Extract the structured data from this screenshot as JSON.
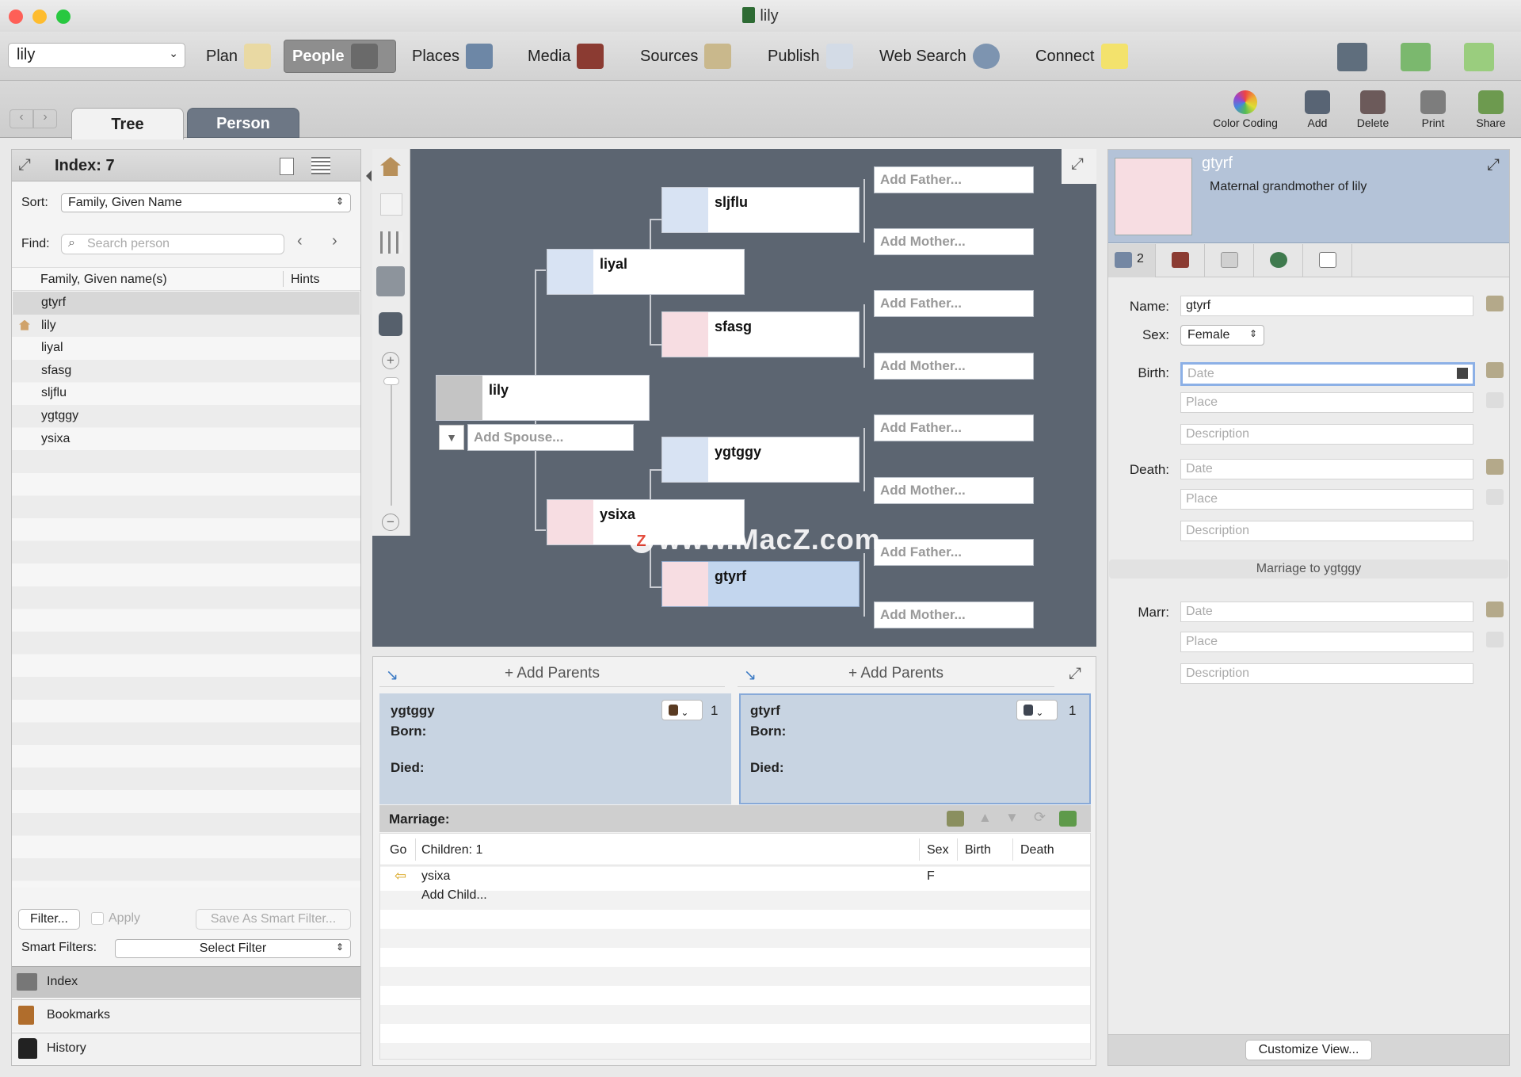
{
  "window": {
    "title": "lily"
  },
  "toolbar": {
    "family_select": "lily",
    "plan": "Plan",
    "people": "People",
    "places": "Places",
    "media": "Media",
    "sources": "Sources",
    "publish": "Publish",
    "web_search": "Web Search",
    "connect": "Connect"
  },
  "tabs": {
    "tree": "Tree",
    "person": "Person"
  },
  "actions": {
    "color_coding": "Color Coding",
    "add": "Add",
    "delete": "Delete",
    "print": "Print",
    "share": "Share"
  },
  "index": {
    "title": "Index: 7",
    "sort_label": "Sort:",
    "sort_value": "Family, Given Name",
    "find_label": "Find:",
    "search_placeholder": "Search person",
    "col_name": "Family, Given name(s)",
    "col_hints": "Hints",
    "people": [
      "gtyrf",
      "lily",
      "liyal",
      "sfasg",
      "sljflu",
      "ygtggy",
      "ysixa"
    ],
    "filter_button": "Filter...",
    "apply": "Apply",
    "save_smart": "Save As Smart Filter...",
    "smart_filters_label": "Smart Filters:",
    "smart_filters_value": "Select Filter",
    "sections": [
      "Index",
      "Bookmarks",
      "History"
    ]
  },
  "tree": {
    "root": "lily",
    "add_spouse": "Add Spouse...",
    "father": "liyal",
    "mother": "ysixa",
    "gp": [
      "sljflu",
      "sfasg",
      "ygtggy",
      "gtyrf"
    ],
    "add_father": "Add Father...",
    "add_mother": "Add Mother...",
    "watermark": "www.MacZ.com"
  },
  "family": {
    "add_parents": "+ Add Parents",
    "left": {
      "name": "ygtggy",
      "born": "Born:",
      "died": "Died:",
      "count": "1"
    },
    "right": {
      "name": "gtyrf",
      "born": "Born:",
      "died": "Died:",
      "count": "1"
    },
    "marriage": "Marriage:",
    "cols": {
      "go": "Go",
      "children": "Children: 1",
      "sex": "Sex",
      "birth": "Birth",
      "death": "Death"
    },
    "child": {
      "name": "ysixa",
      "sex": "F"
    },
    "add_child": "Add Child..."
  },
  "person": {
    "name": "gtyrf",
    "relation": "Maternal grandmother of lily",
    "tab_count": "2",
    "name_label": "Name:",
    "name_value": "gtyrf",
    "sex_label": "Sex:",
    "sex_value": "Female",
    "birth_label": "Birth:",
    "death_label": "Death:",
    "marr_label": "Marr:",
    "date_ph": "Date",
    "place_ph": "Place",
    "desc_ph": "Description",
    "marriage_to": "Marriage to ygtggy",
    "customize": "Customize View..."
  }
}
